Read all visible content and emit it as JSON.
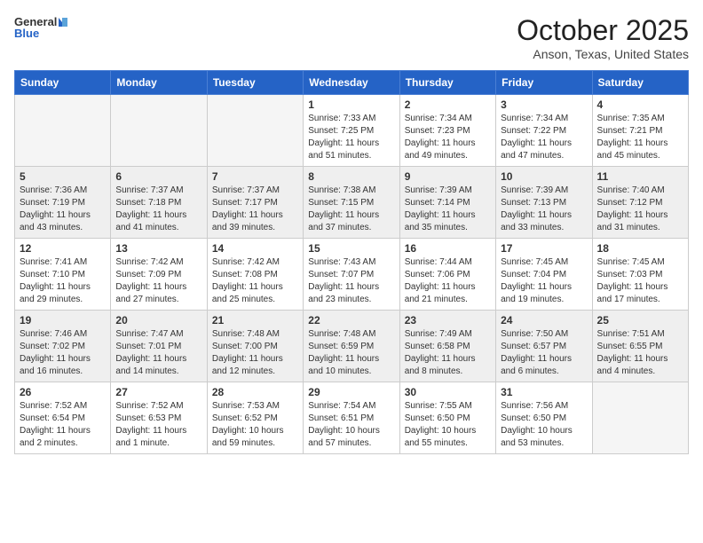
{
  "header": {
    "logo_general": "General",
    "logo_blue": "Blue",
    "month": "October 2025",
    "location": "Anson, Texas, United States"
  },
  "weekdays": [
    "Sunday",
    "Monday",
    "Tuesday",
    "Wednesday",
    "Thursday",
    "Friday",
    "Saturday"
  ],
  "weeks": [
    [
      {
        "day": "",
        "info": ""
      },
      {
        "day": "",
        "info": ""
      },
      {
        "day": "",
        "info": ""
      },
      {
        "day": "1",
        "info": "Sunrise: 7:33 AM\nSunset: 7:25 PM\nDaylight: 11 hours\nand 51 minutes."
      },
      {
        "day": "2",
        "info": "Sunrise: 7:34 AM\nSunset: 7:23 PM\nDaylight: 11 hours\nand 49 minutes."
      },
      {
        "day": "3",
        "info": "Sunrise: 7:34 AM\nSunset: 7:22 PM\nDaylight: 11 hours\nand 47 minutes."
      },
      {
        "day": "4",
        "info": "Sunrise: 7:35 AM\nSunset: 7:21 PM\nDaylight: 11 hours\nand 45 minutes."
      }
    ],
    [
      {
        "day": "5",
        "info": "Sunrise: 7:36 AM\nSunset: 7:19 PM\nDaylight: 11 hours\nand 43 minutes."
      },
      {
        "day": "6",
        "info": "Sunrise: 7:37 AM\nSunset: 7:18 PM\nDaylight: 11 hours\nand 41 minutes."
      },
      {
        "day": "7",
        "info": "Sunrise: 7:37 AM\nSunset: 7:17 PM\nDaylight: 11 hours\nand 39 minutes."
      },
      {
        "day": "8",
        "info": "Sunrise: 7:38 AM\nSunset: 7:15 PM\nDaylight: 11 hours\nand 37 minutes."
      },
      {
        "day": "9",
        "info": "Sunrise: 7:39 AM\nSunset: 7:14 PM\nDaylight: 11 hours\nand 35 minutes."
      },
      {
        "day": "10",
        "info": "Sunrise: 7:39 AM\nSunset: 7:13 PM\nDaylight: 11 hours\nand 33 minutes."
      },
      {
        "day": "11",
        "info": "Sunrise: 7:40 AM\nSunset: 7:12 PM\nDaylight: 11 hours\nand 31 minutes."
      }
    ],
    [
      {
        "day": "12",
        "info": "Sunrise: 7:41 AM\nSunset: 7:10 PM\nDaylight: 11 hours\nand 29 minutes."
      },
      {
        "day": "13",
        "info": "Sunrise: 7:42 AM\nSunset: 7:09 PM\nDaylight: 11 hours\nand 27 minutes."
      },
      {
        "day": "14",
        "info": "Sunrise: 7:42 AM\nSunset: 7:08 PM\nDaylight: 11 hours\nand 25 minutes."
      },
      {
        "day": "15",
        "info": "Sunrise: 7:43 AM\nSunset: 7:07 PM\nDaylight: 11 hours\nand 23 minutes."
      },
      {
        "day": "16",
        "info": "Sunrise: 7:44 AM\nSunset: 7:06 PM\nDaylight: 11 hours\nand 21 minutes."
      },
      {
        "day": "17",
        "info": "Sunrise: 7:45 AM\nSunset: 7:04 PM\nDaylight: 11 hours\nand 19 minutes."
      },
      {
        "day": "18",
        "info": "Sunrise: 7:45 AM\nSunset: 7:03 PM\nDaylight: 11 hours\nand 17 minutes."
      }
    ],
    [
      {
        "day": "19",
        "info": "Sunrise: 7:46 AM\nSunset: 7:02 PM\nDaylight: 11 hours\nand 16 minutes."
      },
      {
        "day": "20",
        "info": "Sunrise: 7:47 AM\nSunset: 7:01 PM\nDaylight: 11 hours\nand 14 minutes."
      },
      {
        "day": "21",
        "info": "Sunrise: 7:48 AM\nSunset: 7:00 PM\nDaylight: 11 hours\nand 12 minutes."
      },
      {
        "day": "22",
        "info": "Sunrise: 7:48 AM\nSunset: 6:59 PM\nDaylight: 11 hours\nand 10 minutes."
      },
      {
        "day": "23",
        "info": "Sunrise: 7:49 AM\nSunset: 6:58 PM\nDaylight: 11 hours\nand 8 minutes."
      },
      {
        "day": "24",
        "info": "Sunrise: 7:50 AM\nSunset: 6:57 PM\nDaylight: 11 hours\nand 6 minutes."
      },
      {
        "day": "25",
        "info": "Sunrise: 7:51 AM\nSunset: 6:55 PM\nDaylight: 11 hours\nand 4 minutes."
      }
    ],
    [
      {
        "day": "26",
        "info": "Sunrise: 7:52 AM\nSunset: 6:54 PM\nDaylight: 11 hours\nand 2 minutes."
      },
      {
        "day": "27",
        "info": "Sunrise: 7:52 AM\nSunset: 6:53 PM\nDaylight: 11 hours\nand 1 minute."
      },
      {
        "day": "28",
        "info": "Sunrise: 7:53 AM\nSunset: 6:52 PM\nDaylight: 10 hours\nand 59 minutes."
      },
      {
        "day": "29",
        "info": "Sunrise: 7:54 AM\nSunset: 6:51 PM\nDaylight: 10 hours\nand 57 minutes."
      },
      {
        "day": "30",
        "info": "Sunrise: 7:55 AM\nSunset: 6:50 PM\nDaylight: 10 hours\nand 55 minutes."
      },
      {
        "day": "31",
        "info": "Sunrise: 7:56 AM\nSunset: 6:50 PM\nDaylight: 10 hours\nand 53 minutes."
      },
      {
        "day": "",
        "info": ""
      }
    ]
  ]
}
